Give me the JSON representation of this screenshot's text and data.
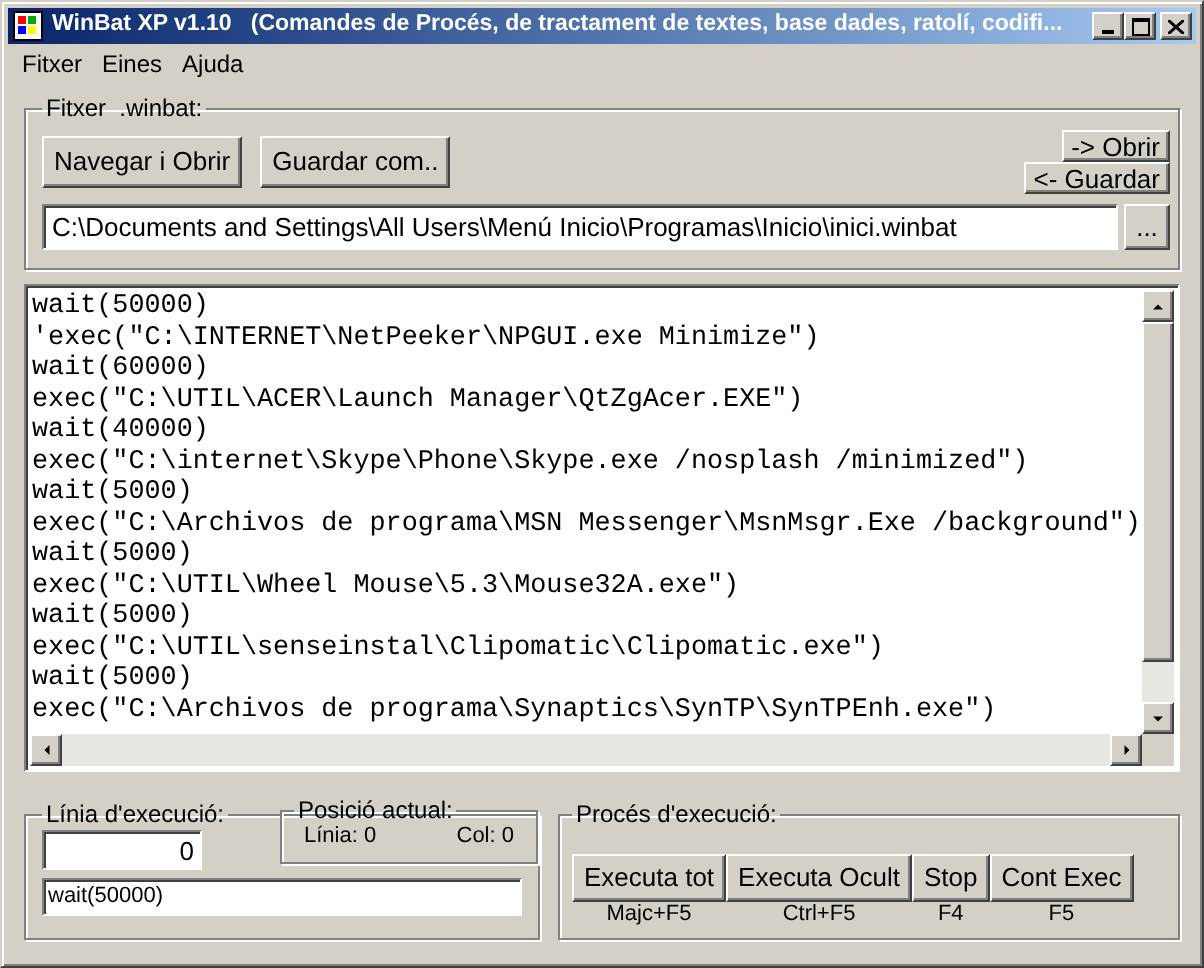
{
  "window": {
    "title": "WinBat XP v1.10   (Comandes de Procés, de tractament de textes, base dades, ratolí, codifi..."
  },
  "menu": [
    {
      "label": "Fitxer"
    },
    {
      "label": "Eines"
    },
    {
      "label": "Ajuda"
    }
  ],
  "file_group": {
    "title": "Fitxer  .winbat:",
    "buttons": [
      {
        "label": "Navegar i Obrir"
      },
      {
        "label": "Guardar com.."
      }
    ],
    "side_buttons": [
      {
        "label": "-> Obrir"
      },
      {
        "label": "<- Guardar"
      }
    ],
    "path": "C:\\Documents and Settings\\All Users\\Menú Inicio\\Programas\\Inicio\\inici.winbat",
    "browse": "..."
  },
  "script_lines": [
    "wait(50000)",
    "'exec(\"C:\\INTERNET\\NetPeeker\\NPGUI.exe Minimize\")",
    "wait(60000)",
    "exec(\"C:\\UTIL\\ACER\\Launch Manager\\QtZgAcer.EXE\")",
    "wait(40000)",
    "exec(\"C:\\internet\\Skype\\Phone\\Skype.exe /nosplash /minimized\")",
    "wait(5000)",
    "exec(\"C:\\Archivos de programa\\MSN Messenger\\MsnMsgr.Exe /background\")",
    "wait(5000)",
    "exec(\"C:\\UTIL\\Wheel Mouse\\5.3\\Mouse32A.exe\")",
    "wait(5000)",
    "exec(\"C:\\UTIL\\senseinstal\\Clipomatic\\Clipomatic.exe\")",
    "wait(5000)",
    "exec(\"C:\\Archivos de programa\\Synaptics\\SynTP\\SynTPEnh.exe\")"
  ],
  "execution_line": {
    "title": "Línia d'execució:",
    "value": "0",
    "command": "wait(50000)"
  },
  "position": {
    "title": "Posició actual:",
    "line_label": "Línia:",
    "line": "0",
    "col_label": "Col:",
    "col": "0"
  },
  "process": {
    "title": "Procés d'execució:",
    "buttons": [
      {
        "label": "Executa tot",
        "shortcut": "Majc+F5"
      },
      {
        "label": "Executa Ocult",
        "shortcut": "Ctrl+F5"
      },
      {
        "label": "Stop",
        "shortcut": "F4"
      },
      {
        "label": "Cont Exec",
        "shortcut": "F5"
      }
    ]
  }
}
